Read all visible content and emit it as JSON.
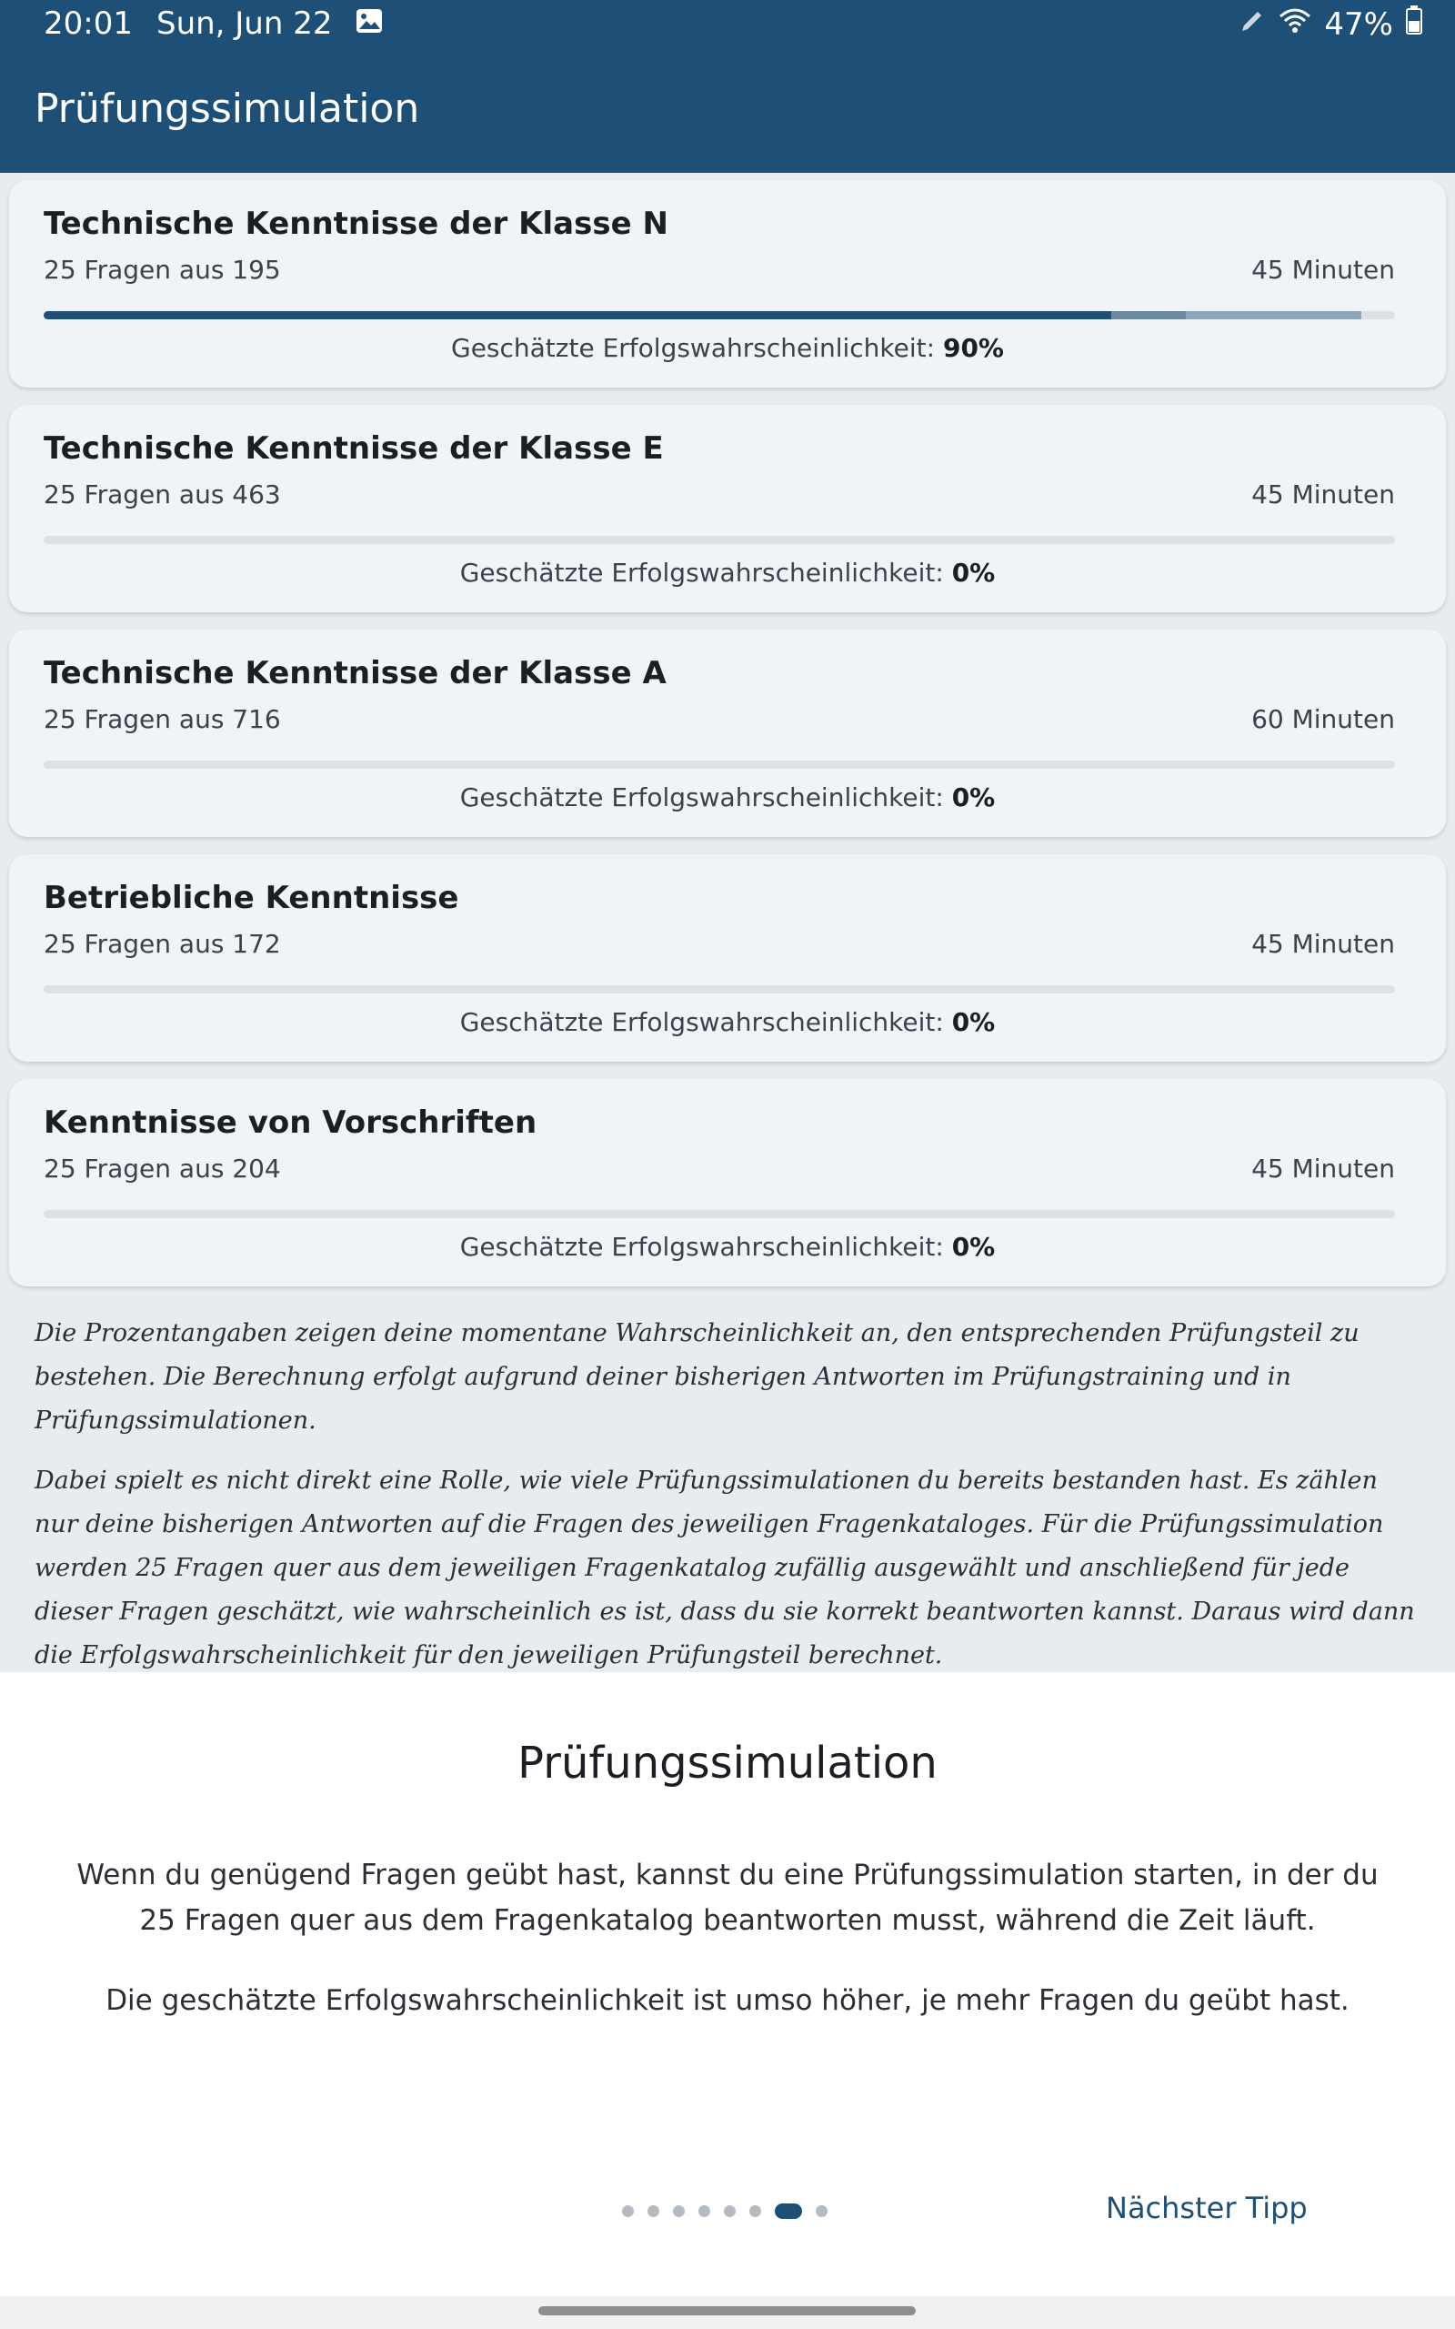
{
  "status_bar": {
    "time": "20:01",
    "date": "Sun, Jun 22",
    "battery": "47%",
    "icons": [
      "image-icon",
      "pen-icon",
      "wifi-icon",
      "battery-icon"
    ]
  },
  "app_bar": {
    "title": "Prüfungssimulation"
  },
  "exams": [
    {
      "title": "Technische Kenntnisse der Klasse N",
      "count": "25 Fragen aus 195",
      "duration": "45 Minuten",
      "prob_label": "Geschätzte Erfolgswahrscheinlichkeit:",
      "prob_value": "90%",
      "progress_segments": [
        0.79,
        0.055,
        0.13
      ]
    },
    {
      "title": "Technische Kenntnisse der Klasse E",
      "count": "25 Fragen aus 463",
      "duration": "45 Minuten",
      "prob_label": "Geschätzte Erfolgswahrscheinlichkeit:",
      "prob_value": "0%",
      "progress_segments": [
        0,
        0,
        0
      ]
    },
    {
      "title": "Technische Kenntnisse der Klasse A",
      "count": "25 Fragen aus 716",
      "duration": "60 Minuten",
      "prob_label": "Geschätzte Erfolgswahrscheinlichkeit:",
      "prob_value": "0%",
      "progress_segments": [
        0,
        0,
        0
      ]
    },
    {
      "title": "Betriebliche Kenntnisse",
      "count": "25 Fragen aus 172",
      "duration": "45 Minuten",
      "prob_label": "Geschätzte Erfolgswahrscheinlichkeit:",
      "prob_value": "0%",
      "progress_segments": [
        0,
        0,
        0
      ]
    },
    {
      "title": "Kenntnisse von Vorschriften",
      "count": "25 Fragen aus 204",
      "duration": "45 Minuten",
      "prob_label": "Geschätzte Erfolgswahrscheinlichkeit:",
      "prob_value": "0%",
      "progress_segments": [
        0,
        0,
        0
      ]
    }
  ],
  "progress_colors": [
    "#1d4f77",
    "#6d8aa3",
    "#8ea4b8"
  ],
  "info": {
    "paragraph1": "Die Prozentangaben zeigen deine momentane Wahrscheinlichkeit an, den entsprechenden Prüfungsteil zu bestehen. Die Berechnung erfolgt aufgrund deiner bisherigen Antworten im Prüfungstraining und in Prüfungssimulationen.",
    "paragraph2": "Dabei spielt es nicht direkt eine Rolle, wie viele Prüfungssimulationen du bereits bestanden hast. Es zählen nur deine bisherigen Antworten auf die Fragen des jeweiligen Fragenkataloges. Für die Prüfungssimulation werden 25 Fragen quer aus dem jeweiligen Fragenkatalog zufällig ausgewählt und anschließend für jede dieser Fragen geschätzt, wie wahrscheinlich es ist, dass du sie korrekt beantworten kannst. Daraus wird dann die Erfolgswahrscheinlichkeit für den jeweiligen Prüfungsteil berechnet."
  },
  "tip_sheet": {
    "title": "Prüfungssimulation",
    "text1": "Wenn du genügend Fragen geübt hast, kannst du eine Prüfungssimulation starten, in der du 25 Fragen quer aus dem Fragenkatalog beantworten musst, während die Zeit läuft.",
    "text2": "Die geschätzte Erfolgswahrscheinlichkeit ist umso höher, je mehr Fragen du geübt hast.",
    "page_count": 8,
    "active_page": 6,
    "next_label": "Nächster Tipp"
  }
}
